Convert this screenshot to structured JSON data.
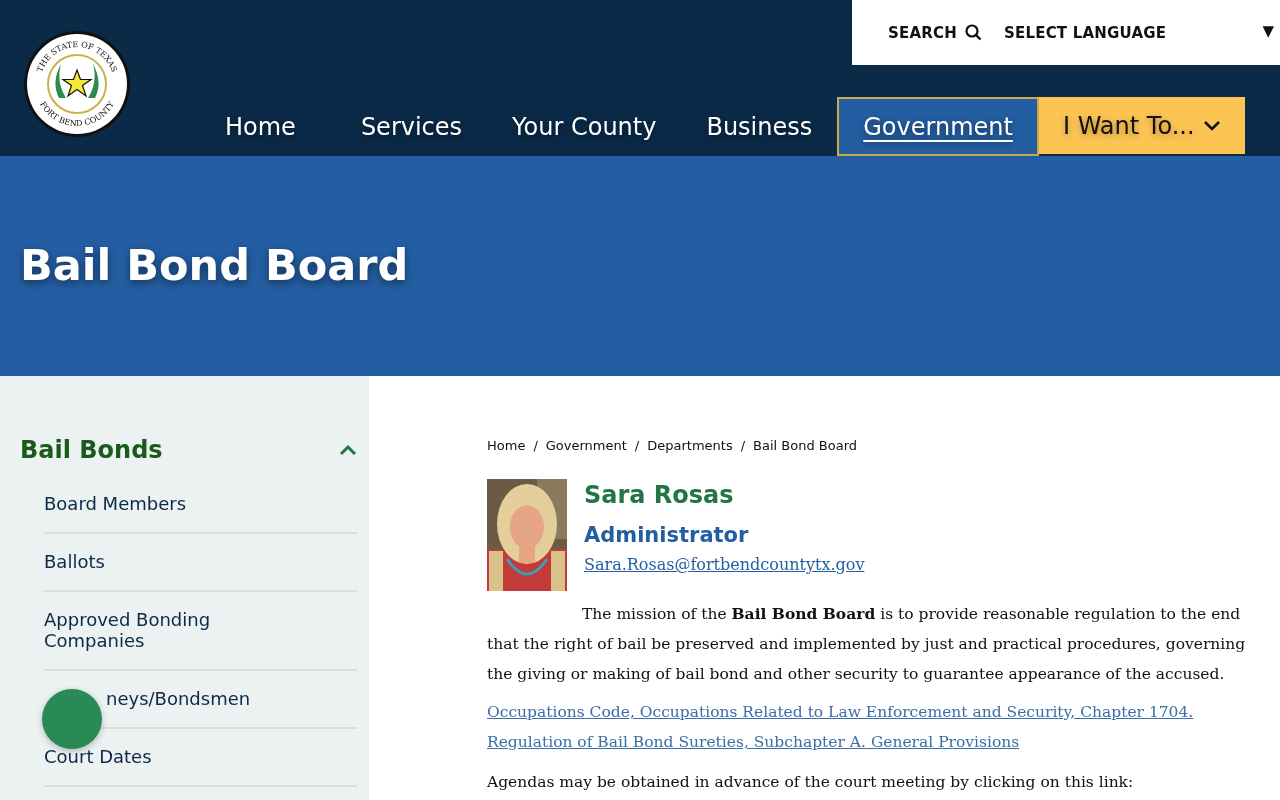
{
  "logo": {
    "top_text": "THE STATE OF TEXAS",
    "bottom_text": "FORT BEND COUNTY"
  },
  "utility": {
    "search": "SEARCH",
    "language": "SELECT LANGUAGE",
    "caret": "▼"
  },
  "nav": [
    {
      "label": "Home",
      "selected": false,
      "kind": "link"
    },
    {
      "label": "Services",
      "selected": false,
      "kind": "link"
    },
    {
      "label": "Your County",
      "selected": false,
      "kind": "link"
    },
    {
      "label": "Business",
      "selected": false,
      "kind": "link"
    },
    {
      "label": "Government",
      "selected": true,
      "kind": "link"
    },
    {
      "label": "I Want To...",
      "selected": false,
      "kind": "menu"
    }
  ],
  "hero": {
    "title": "Bail Bond Board"
  },
  "sidebar": {
    "heading": "Bail Bonds",
    "expanded": true,
    "items": [
      {
        "label": "Board Members",
        "covered": false
      },
      {
        "label": "Ballots",
        "covered": false
      },
      {
        "label": "Approved Bonding Companies",
        "covered": false
      },
      {
        "label": "neys/Bondsmen",
        "covered": true
      },
      {
        "label": "Court Dates",
        "covered": false
      }
    ]
  },
  "breadcrumb": [
    {
      "label": "Home",
      "separator": "/"
    },
    {
      "label": "Government",
      "separator": "/"
    },
    {
      "label": "Departments",
      "separator": "/"
    },
    {
      "label": "Bail Bond Board"
    }
  ],
  "contact": {
    "name": "Sara Rosas",
    "title": "Administrator",
    "email": "Sara.Rosas@fortbendcountytx.gov"
  },
  "mission": "The mission of the **Bail Bond Board** is to provide reasonable regulation to the end that the right of bail be preserved and implemented by just and practical procedures, governing the giving or making of bail bond and other security to guarantee appearance of the accused.",
  "statute_link": "Occupations Code, Occupations Related to Law Enforcement and Security, Chapter 1704. Regulation of Bail Bond Sureties, Subchapter A. General Provisions",
  "agendas_text": "Agendas may be obtained in advance of the court meeting by clicking on this link:"
}
